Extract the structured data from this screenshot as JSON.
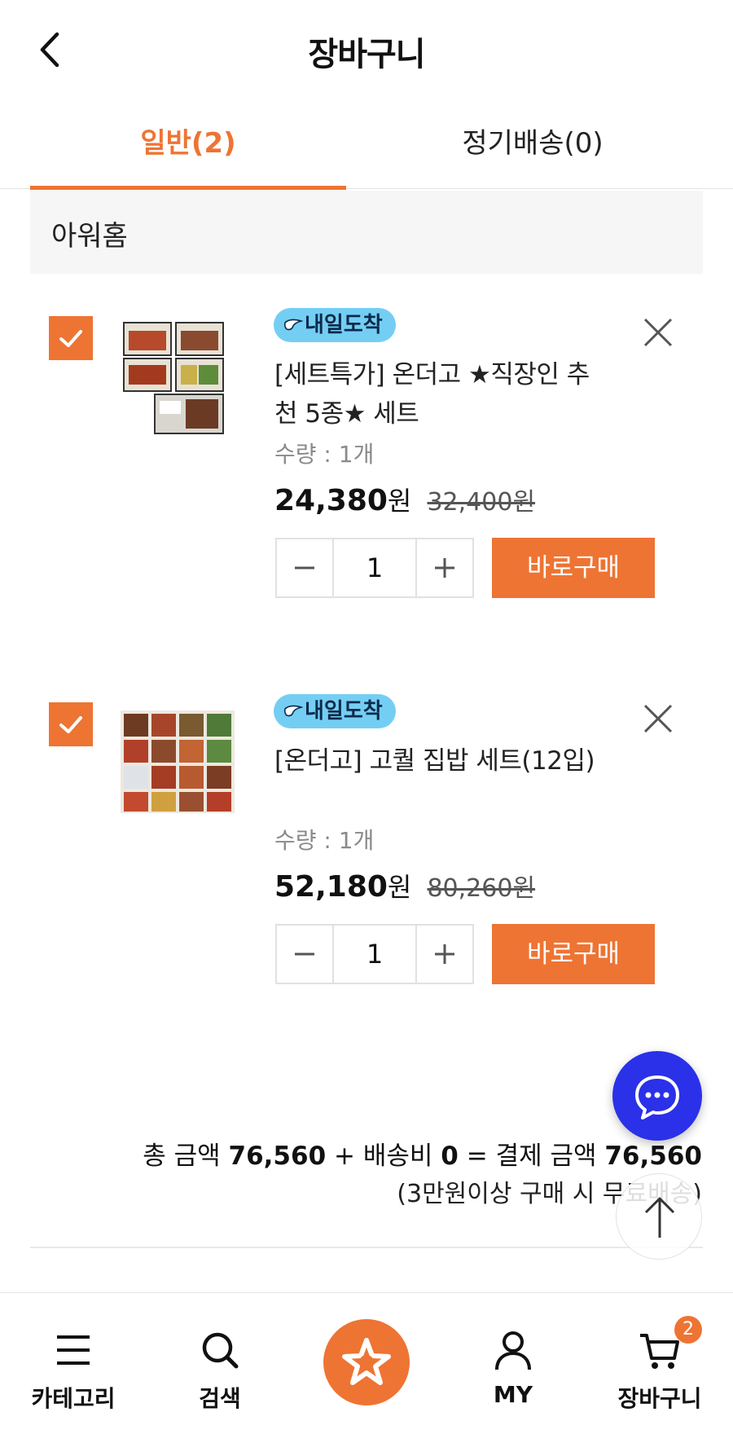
{
  "header": {
    "title": "장바구니"
  },
  "tabs": [
    {
      "label": "일반(2)",
      "active": true
    },
    {
      "label": "정기배송(0)",
      "active": false
    }
  ],
  "store": {
    "name": "아워홈"
  },
  "items": [
    {
      "badge": "내일도착",
      "name": "[세트특가] 온더고 ★직장인 추천 5종★ 세트",
      "quantity_label": "수량 : 1개",
      "price": "24,380",
      "currency": "원",
      "original_price": "32,400원",
      "qty": "1",
      "buy_label": "바로구매",
      "checked": true
    },
    {
      "badge": "내일도착",
      "name": "[온더고] 고퀄 집밥 세트(12입)",
      "quantity_label": "수량 : 1개",
      "price": "52,180",
      "currency": "원",
      "original_price": "80,260원",
      "qty": "1",
      "buy_label": "바로구매",
      "checked": true
    }
  ],
  "summary": {
    "total_label": "총 금액",
    "total": "76,560",
    "plus": "+",
    "shipping_label": "배송비",
    "shipping": "0",
    "equals": "=",
    "pay_label": "결제 금액",
    "pay": "76,560",
    "note": "(3만원이상 구매 시 무료배송)"
  },
  "nav": {
    "category": "카테고리",
    "search": "검색",
    "my": "MY",
    "cart": "장바구니",
    "cart_count": "2"
  },
  "colors": {
    "accent": "#ee7433",
    "chat": "#2a31e8",
    "badge": "#74cef4"
  },
  "icons": {
    "back": "chevron-left-icon",
    "remove": "close-icon",
    "chat": "chat-bubble-icon",
    "top": "arrow-up-icon"
  }
}
